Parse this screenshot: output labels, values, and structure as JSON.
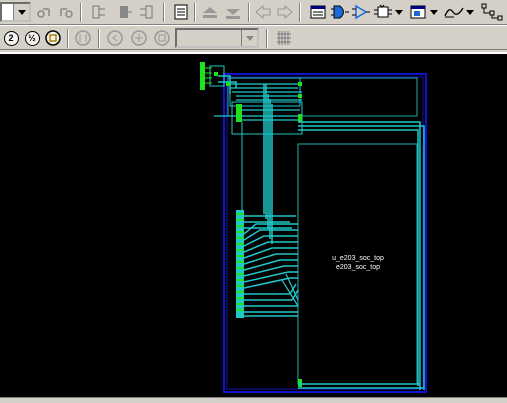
{
  "toolbar_top": {
    "buttons": [
      {
        "icon": "dropdown-arrow-icon"
      },
      {
        "icon": "back-history-icon"
      },
      {
        "icon": "forward-history-icon"
      },
      {
        "icon": "schematic-push-icon"
      },
      {
        "icon": "schematic-pop-icon"
      },
      {
        "icon": "schematic-hier-icon"
      },
      {
        "icon": "report-icon"
      },
      {
        "icon": "move-up-icon"
      },
      {
        "icon": "move-down-icon"
      },
      {
        "icon": "left-arrow-icon"
      },
      {
        "icon": "right-arrow-icon"
      },
      {
        "icon": "list-view-icon"
      },
      {
        "icon": "gate-icon"
      },
      {
        "icon": "buffer-icon"
      },
      {
        "icon": "flipflop-icon"
      },
      {
        "icon": "window-icon"
      },
      {
        "icon": "waveform-icon"
      },
      {
        "icon": "hierarchy-icon"
      }
    ]
  },
  "toolbar_second": {
    "buttons": [
      {
        "icon": "zoom-2-icon",
        "text": "2"
      },
      {
        "icon": "zoom-half-icon",
        "text": "½"
      },
      {
        "icon": "zoom-box-icon"
      },
      {
        "icon": "zoom-fit-icon"
      },
      {
        "icon": "zoom-in-icon"
      },
      {
        "icon": "zoom-out-icon"
      },
      {
        "icon": "zoom-select-icon"
      },
      {
        "icon": "grid-icon"
      }
    ],
    "combo_value": ""
  },
  "schematic": {
    "instance_name": "u_e203_soc_top",
    "module_name": "e203_soc_top",
    "colors": {
      "background": "#000000",
      "wire": "#20c8c8",
      "box": "#2a9d9d",
      "outer": "#1010d0",
      "pin": "#20e020"
    }
  }
}
